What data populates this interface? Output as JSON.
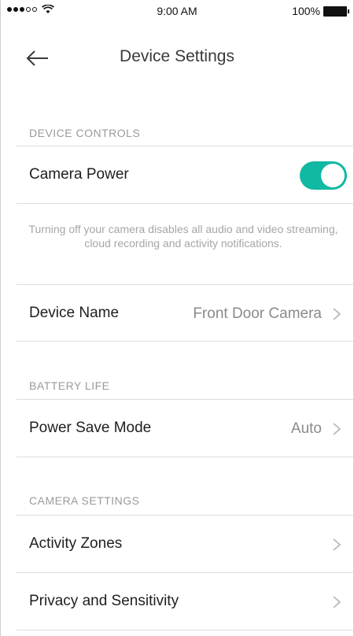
{
  "status_bar": {
    "time": "9:00 AM",
    "battery_percent": "100%",
    "signal_bars_filled": 3,
    "signal_bars_total": 5
  },
  "header": {
    "title": "Device Settings",
    "back_icon": "arrow-left-icon"
  },
  "sections": {
    "device_controls": {
      "title": "DEVICE CONTROLS",
      "camera_power": {
        "label": "Camera Power",
        "enabled": true
      },
      "helper_text": "Turning off your camera disables all audio and video streaming, cloud recording and activity notifications.",
      "device_name": {
        "label": "Device Name",
        "value": "Front Door Camera"
      }
    },
    "battery_life": {
      "title": "BATTERY LIFE",
      "power_save_mode": {
        "label": "Power Save Mode",
        "value": "Auto"
      }
    },
    "camera_settings": {
      "title": "CAMERA SETTINGS",
      "activity_zones": {
        "label": "Activity Zones"
      },
      "privacy_sensitivity": {
        "label": "Privacy and Sensitivity"
      }
    }
  },
  "colors": {
    "accent": "#10b9a2",
    "section_header": "#9a9a9a",
    "value_text": "#8a8a8a",
    "divider": "#dcdcdc"
  }
}
